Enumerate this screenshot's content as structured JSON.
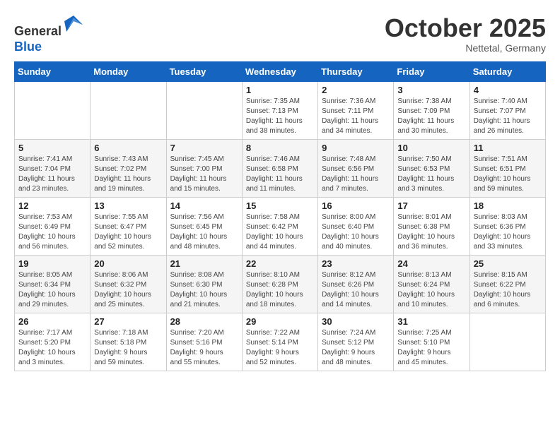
{
  "header": {
    "logo_line1": "General",
    "logo_line2": "Blue",
    "month": "October 2025",
    "location": "Nettetal, Germany"
  },
  "weekdays": [
    "Sunday",
    "Monday",
    "Tuesday",
    "Wednesday",
    "Thursday",
    "Friday",
    "Saturday"
  ],
  "weeks": [
    [
      {
        "day": "",
        "info": ""
      },
      {
        "day": "",
        "info": ""
      },
      {
        "day": "",
        "info": ""
      },
      {
        "day": "1",
        "info": "Sunrise: 7:35 AM\nSunset: 7:13 PM\nDaylight: 11 hours\nand 38 minutes."
      },
      {
        "day": "2",
        "info": "Sunrise: 7:36 AM\nSunset: 7:11 PM\nDaylight: 11 hours\nand 34 minutes."
      },
      {
        "day": "3",
        "info": "Sunrise: 7:38 AM\nSunset: 7:09 PM\nDaylight: 11 hours\nand 30 minutes."
      },
      {
        "day": "4",
        "info": "Sunrise: 7:40 AM\nSunset: 7:07 PM\nDaylight: 11 hours\nand 26 minutes."
      }
    ],
    [
      {
        "day": "5",
        "info": "Sunrise: 7:41 AM\nSunset: 7:04 PM\nDaylight: 11 hours\nand 23 minutes."
      },
      {
        "day": "6",
        "info": "Sunrise: 7:43 AM\nSunset: 7:02 PM\nDaylight: 11 hours\nand 19 minutes."
      },
      {
        "day": "7",
        "info": "Sunrise: 7:45 AM\nSunset: 7:00 PM\nDaylight: 11 hours\nand 15 minutes."
      },
      {
        "day": "8",
        "info": "Sunrise: 7:46 AM\nSunset: 6:58 PM\nDaylight: 11 hours\nand 11 minutes."
      },
      {
        "day": "9",
        "info": "Sunrise: 7:48 AM\nSunset: 6:56 PM\nDaylight: 11 hours\nand 7 minutes."
      },
      {
        "day": "10",
        "info": "Sunrise: 7:50 AM\nSunset: 6:53 PM\nDaylight: 11 hours\nand 3 minutes."
      },
      {
        "day": "11",
        "info": "Sunrise: 7:51 AM\nSunset: 6:51 PM\nDaylight: 10 hours\nand 59 minutes."
      }
    ],
    [
      {
        "day": "12",
        "info": "Sunrise: 7:53 AM\nSunset: 6:49 PM\nDaylight: 10 hours\nand 56 minutes."
      },
      {
        "day": "13",
        "info": "Sunrise: 7:55 AM\nSunset: 6:47 PM\nDaylight: 10 hours\nand 52 minutes."
      },
      {
        "day": "14",
        "info": "Sunrise: 7:56 AM\nSunset: 6:45 PM\nDaylight: 10 hours\nand 48 minutes."
      },
      {
        "day": "15",
        "info": "Sunrise: 7:58 AM\nSunset: 6:42 PM\nDaylight: 10 hours\nand 44 minutes."
      },
      {
        "day": "16",
        "info": "Sunrise: 8:00 AM\nSunset: 6:40 PM\nDaylight: 10 hours\nand 40 minutes."
      },
      {
        "day": "17",
        "info": "Sunrise: 8:01 AM\nSunset: 6:38 PM\nDaylight: 10 hours\nand 36 minutes."
      },
      {
        "day": "18",
        "info": "Sunrise: 8:03 AM\nSunset: 6:36 PM\nDaylight: 10 hours\nand 33 minutes."
      }
    ],
    [
      {
        "day": "19",
        "info": "Sunrise: 8:05 AM\nSunset: 6:34 PM\nDaylight: 10 hours\nand 29 minutes."
      },
      {
        "day": "20",
        "info": "Sunrise: 8:06 AM\nSunset: 6:32 PM\nDaylight: 10 hours\nand 25 minutes."
      },
      {
        "day": "21",
        "info": "Sunrise: 8:08 AM\nSunset: 6:30 PM\nDaylight: 10 hours\nand 21 minutes."
      },
      {
        "day": "22",
        "info": "Sunrise: 8:10 AM\nSunset: 6:28 PM\nDaylight: 10 hours\nand 18 minutes."
      },
      {
        "day": "23",
        "info": "Sunrise: 8:12 AM\nSunset: 6:26 PM\nDaylight: 10 hours\nand 14 minutes."
      },
      {
        "day": "24",
        "info": "Sunrise: 8:13 AM\nSunset: 6:24 PM\nDaylight: 10 hours\nand 10 minutes."
      },
      {
        "day": "25",
        "info": "Sunrise: 8:15 AM\nSunset: 6:22 PM\nDaylight: 10 hours\nand 6 minutes."
      }
    ],
    [
      {
        "day": "26",
        "info": "Sunrise: 7:17 AM\nSunset: 5:20 PM\nDaylight: 10 hours\nand 3 minutes."
      },
      {
        "day": "27",
        "info": "Sunrise: 7:18 AM\nSunset: 5:18 PM\nDaylight: 9 hours\nand 59 minutes."
      },
      {
        "day": "28",
        "info": "Sunrise: 7:20 AM\nSunset: 5:16 PM\nDaylight: 9 hours\nand 55 minutes."
      },
      {
        "day": "29",
        "info": "Sunrise: 7:22 AM\nSunset: 5:14 PM\nDaylight: 9 hours\nand 52 minutes."
      },
      {
        "day": "30",
        "info": "Sunrise: 7:24 AM\nSunset: 5:12 PM\nDaylight: 9 hours\nand 48 minutes."
      },
      {
        "day": "31",
        "info": "Sunrise: 7:25 AM\nSunset: 5:10 PM\nDaylight: 9 hours\nand 45 minutes."
      },
      {
        "day": "",
        "info": ""
      }
    ]
  ]
}
